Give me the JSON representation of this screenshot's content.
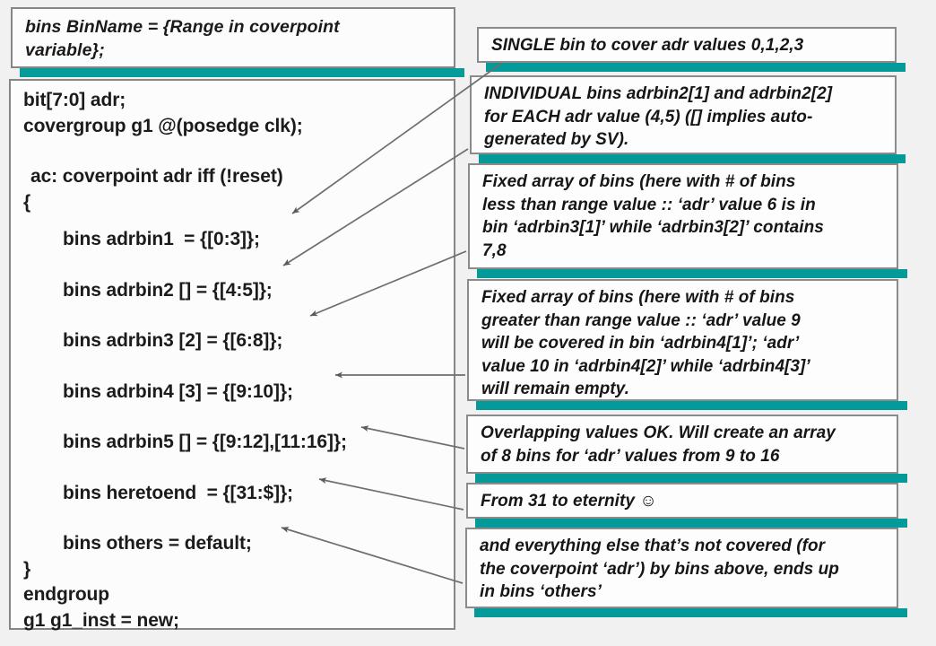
{
  "background_color": "#f1f1f1",
  "accent_color": "#069b9b",
  "border_color": "#868686",
  "text_color": "#1a1a1a",
  "syntax_box": {
    "line1": "bins BinName = {Range in coverpoint",
    "line2": "variable};"
  },
  "code_box": {
    "lines": [
      "bit[7:0] adr;",
      "covergroup g1 @(posedge clk);",
      "  ac: coverpoint adr iff (!reset)",
      "{",
      "   bins adrbin1  = {[0:3]};",
      "   bins adrbin2 [] = {[4:5]};",
      "   bins adrbin3 [2] = {[6:8]};",
      "   bins adrbin4 [3] = {[9:10]};",
      "   bins adrbin5 [] = {[9:12],[11:16]};",
      "   bins heretoend  = {[31:$]};",
      "   bins others = default;",
      "}",
      "endgroup",
      "g1 g1_inst = new;"
    ],
    "line_0": "bit[7:0] adr;",
    "line_1": "covergroup g1 @(posedge clk);",
    "line_2": "ac: coverpoint adr iff (!reset)",
    "line_3": "{",
    "line_4": "bins adrbin1  = {[0:3]};",
    "line_5": "bins adrbin2 [] = {[4:5]};",
    "line_6": "bins adrbin3 [2] = {[6:8]};",
    "line_7": "bins adrbin4 [3] = {[9:10]};",
    "line_8": "bins adrbin5 [] = {[9:12],[11:16]};",
    "line_9": "bins heretoend  = {[31:$]};",
    "line_10": "bins others = default;",
    "line_11": "}",
    "line_12": "endgroup",
    "line_13": "g1 g1_inst = new;"
  },
  "callouts": [
    {
      "id": "callout-1",
      "target": "bins adrbin1 = {[0:3]};",
      "lines": [
        "SINGLE bin to cover adr values 0,1,2,3"
      ],
      "l0": "SINGLE bin to cover adr values 0,1,2,3"
    },
    {
      "id": "callout-2",
      "target": "bins adrbin2 [] = {[4:5]};",
      "lines": [
        "INDIVIDUAL bins adrbin2[1] and adrbin2[2]",
        "for EACH adr value (4,5) ([] implies auto-",
        "generated by SV)."
      ],
      "l0": "INDIVIDUAL bins adrbin2[1] and adrbin2[2]",
      "l1": "for EACH adr value (4,5) ([] implies auto-",
      "l2": "generated by SV)."
    },
    {
      "id": "callout-3",
      "target": "bins adrbin3 [2] = {[6:8]};",
      "lines": [
        "Fixed array of bins (here with # of bins",
        "less than range value :: ‘adr’ value 6 is in",
        "bin ‘adrbin3[1]’ while ‘adrbin3[2]’ contains",
        "7,8"
      ],
      "l0": "Fixed array of bins (here with # of bins",
      "l1": "less than range value :: ‘adr’ value 6 is in",
      "l2": "bin ‘adrbin3[1]’ while ‘adrbin3[2]’ contains",
      "l3": "7,8"
    },
    {
      "id": "callout-4",
      "target": "bins adrbin4 [3] = {[9:10]};",
      "lines": [
        "Fixed array of bins (here with # of bins",
        "greater  than range value :: ‘adr’ value 9",
        "will be covered in bin ‘adrbin4[1]’; ‘adr’",
        "value 10 in ‘adrbin4[2]’ while ‘adrbin4[3]’",
        "will remain empty."
      ],
      "l0": "Fixed array of bins (here with # of bins",
      "l1": "greater  than range value :: ‘adr’ value 9",
      "l2": "will be covered in bin ‘adrbin4[1]’; ‘adr’",
      "l3": "value 10 in ‘adrbin4[2]’ while ‘adrbin4[3]’",
      "l4": "will remain empty."
    },
    {
      "id": "callout-5",
      "target": "bins adrbin5 [] = {[9:12],[11:16]};",
      "lines": [
        "Overlapping values OK. Will create an array",
        "of 8 bins for ‘adr’ values from 9 to 16"
      ],
      "l0": "Overlapping values OK. Will create an array",
      "l1": "of 8 bins for ‘adr’ values from 9 to 16"
    },
    {
      "id": "callout-6",
      "target": "bins heretoend = {[31:$]};",
      "lines": [
        "From 31 to eternity ☺"
      ],
      "l0": "From 31 to eternity ☺"
    },
    {
      "id": "callout-7",
      "target": "bins others = default;",
      "lines": [
        "and everything else that’s not covered (for",
        "the coverpoint ‘adr’) by bins above, ends up",
        "in bins ‘others’"
      ],
      "l0": "and everything else that’s not covered (for",
      "l1": "the coverpoint ‘adr’) by bins above, ends up",
      "l2": "in bins ‘others’"
    }
  ]
}
